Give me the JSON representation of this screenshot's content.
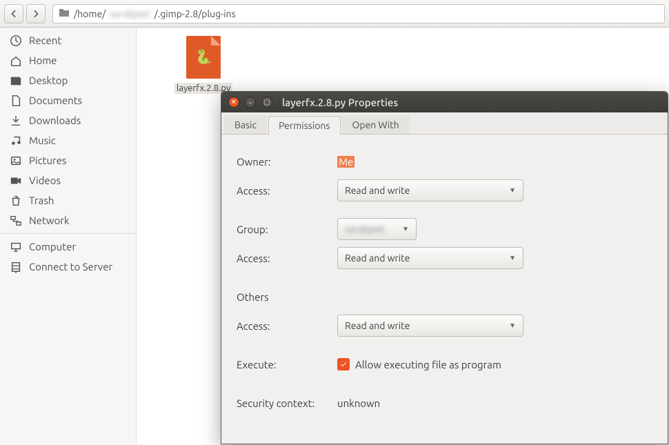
{
  "toolbar": {
    "path_prefix": "/home/",
    "path_blur": "sarabjeet",
    "path_suffix": "/.gimp-2.8/plug-ins"
  },
  "sidebar": {
    "group1": [
      {
        "icon": "recent",
        "label": "Recent"
      },
      {
        "icon": "home",
        "label": "Home"
      },
      {
        "icon": "desktop",
        "label": "Desktop"
      },
      {
        "icon": "documents",
        "label": "Documents"
      },
      {
        "icon": "downloads",
        "label": "Downloads"
      },
      {
        "icon": "music",
        "label": "Music"
      },
      {
        "icon": "pictures",
        "label": "Pictures"
      },
      {
        "icon": "videos",
        "label": "Videos"
      },
      {
        "icon": "trash",
        "label": "Trash"
      },
      {
        "icon": "network",
        "label": "Network"
      }
    ],
    "group2": [
      {
        "icon": "computer",
        "label": "Computer"
      },
      {
        "icon": "server",
        "label": "Connect to Server"
      }
    ]
  },
  "file": {
    "name": "layerfx.2.8.py"
  },
  "dialog": {
    "title": "layerfx.2.8.py Properties",
    "tabs": [
      "Basic",
      "Permissions",
      "Open With"
    ],
    "active_tab": 1,
    "owner_label": "Owner:",
    "owner_value": "Me",
    "owner_access_label": "Access:",
    "owner_access_value": "Read and write",
    "group_label": "Group:",
    "group_value": "sarabjeet",
    "group_access_label": "Access:",
    "group_access_value": "Read and write",
    "others_label": "Others",
    "others_access_label": "Access:",
    "others_access_value": "Read and write",
    "execute_label": "Execute:",
    "execute_text": "Allow executing file as program",
    "execute_checked": true,
    "security_label": "Security context:",
    "security_value": "unknown"
  }
}
